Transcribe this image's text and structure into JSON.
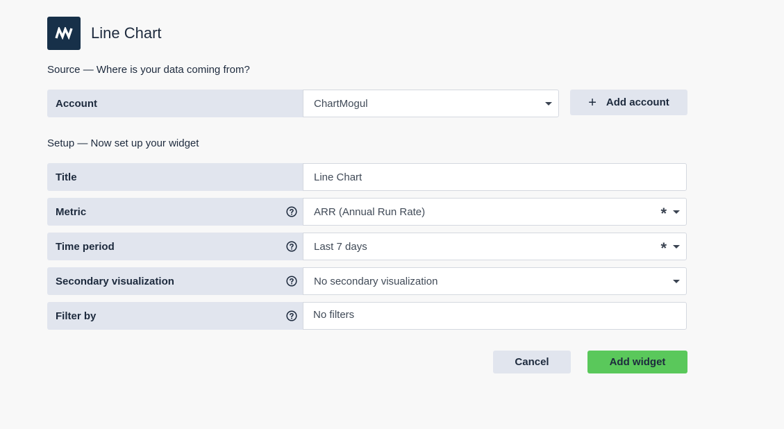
{
  "header": {
    "title": "Line Chart",
    "logo_icon": "chartmogul-logo"
  },
  "source": {
    "section_label": "Source — Where is your data coming from?",
    "account": {
      "label": "Account",
      "value": "ChartMogul"
    },
    "add_account_label": "Add account"
  },
  "setup": {
    "section_label": "Setup — Now set up your widget",
    "title_field": {
      "label": "Title",
      "value": "Line Chart"
    },
    "metric": {
      "label": "Metric",
      "value": "ARR (Annual Run Rate)",
      "required": "*"
    },
    "time_period": {
      "label": "Time period",
      "value": "Last 7 days",
      "required": "*"
    },
    "secondary_visualization": {
      "label": "Secondary visualization",
      "value": "No secondary visualization"
    },
    "filter_by": {
      "label": "Filter by",
      "value": "No filters"
    }
  },
  "actions": {
    "cancel_label": "Cancel",
    "add_widget_label": "Add widget"
  },
  "colors": {
    "logo_bg": "#173049",
    "label_bg": "#e1e5ee",
    "primary": "#5ac85b",
    "text": "#1d2a3d"
  }
}
